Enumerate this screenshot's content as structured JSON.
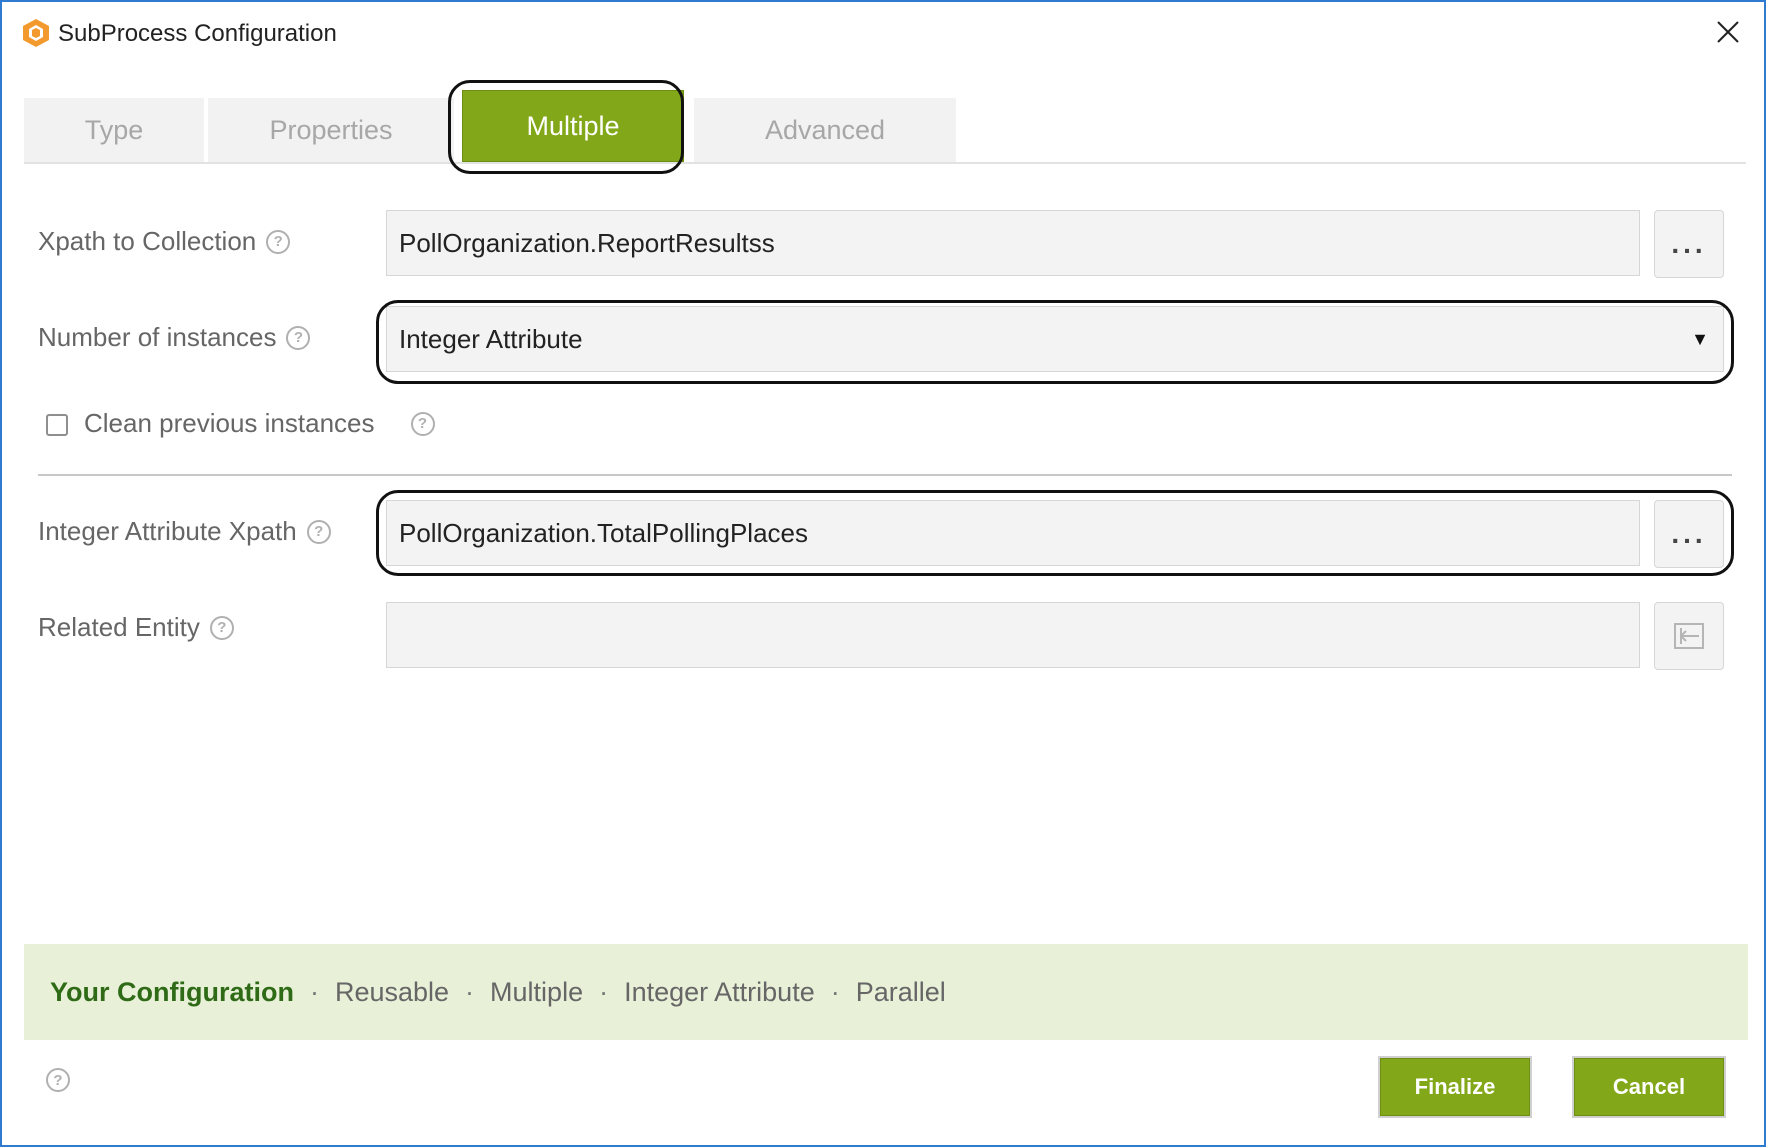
{
  "window": {
    "title": "SubProcess Configuration"
  },
  "tabs": [
    {
      "label": "Type",
      "selected": false
    },
    {
      "label": "Properties",
      "selected": false
    },
    {
      "label": "Multiple",
      "selected": true
    },
    {
      "label": "Advanced",
      "selected": false
    }
  ],
  "form": {
    "xpath_collection": {
      "label": "Xpath to Collection",
      "value": "PollOrganization.ReportResultss"
    },
    "number_instances": {
      "label": "Number of instances",
      "value": "Integer Attribute"
    },
    "clean_previous": {
      "label": "Clean previous instances",
      "checked": false
    },
    "integer_xpath": {
      "label": "Integer Attribute Xpath",
      "value": "PollOrganization.TotalPollingPlaces"
    },
    "related_entity": {
      "label": "Related Entity",
      "value": ""
    },
    "browse_label": "..."
  },
  "summary": {
    "heading": "Your Configuration",
    "items": [
      "Reusable",
      "Multiple",
      "Integer Attribute",
      "Parallel"
    ],
    "separator": "·"
  },
  "buttons": {
    "finalize": "Finalize",
    "cancel": "Cancel"
  },
  "icons": {
    "help": "?"
  },
  "colors": {
    "accent_green": "#82a819",
    "summary_bg": "#e8f0d8",
    "window_border": "#2e7bcf",
    "app_icon_orange": "#f29a2e"
  }
}
